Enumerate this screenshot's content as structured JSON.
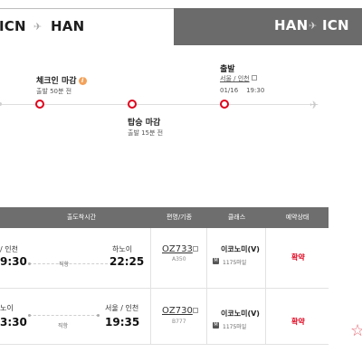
{
  "route_tabs": {
    "outbound": {
      "from": "ICN",
      "to": "HAN",
      "arrow": "✈"
    },
    "return": {
      "from": "HAN",
      "to": "ICN",
      "arrow": "✈"
    }
  },
  "timeline": {
    "checkin": {
      "title": "체크인 마감",
      "sub": "출발 50분 전"
    },
    "boarding": {
      "title": "탑승 마감",
      "sub": "출발 15분 전"
    },
    "departure": {
      "title": "출발",
      "location": "서울 / 인천",
      "date": "01/16",
      "time": "19:30"
    }
  },
  "table": {
    "headers": {
      "schedule": "출도착시간",
      "flight": "편명/기종",
      "class": "클래스",
      "status": "예약상태"
    },
    "rows": [
      {
        "dep_city": "/ 인천",
        "dep_time": "9:30",
        "arr_city": "하노이",
        "arr_time": "22:25",
        "direct": "직항",
        "flight_no": "OZ733",
        "aircraft": "A350",
        "class": "이코노미(V)",
        "miles": "1175마일",
        "status": "확약"
      },
      {
        "dep_city": "노이",
        "dep_time": "3:30",
        "arr_city": "서울 / 인천",
        "arr_time": "19:35",
        "direct": "직항",
        "flight_no": "OZ730",
        "aircraft": "B777",
        "class": "이코노미(V)",
        "miles": "1175마일",
        "status": "확약"
      }
    ]
  },
  "icons": {
    "info": "i",
    "miles_badge": "M",
    "star": "☆",
    "plane": "✈"
  },
  "colors": {
    "accent": "#e0001b",
    "header_bg": "#6e6e6e",
    "return_tab_bg": "#6b6b6b"
  }
}
